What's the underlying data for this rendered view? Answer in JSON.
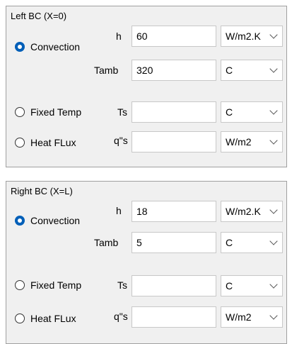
{
  "left_bc": {
    "title": "Left BC (X=0)",
    "convection_label": "Convection",
    "h_label": "h",
    "h_value": "60",
    "h_unit": "W/m2.K",
    "tamb_label": "Tamb",
    "tamb_value": "320",
    "tamb_unit": "C",
    "fixed_temp_label": "Fixed Temp",
    "ts_label": "Ts",
    "ts_value": "",
    "ts_unit": "C",
    "heat_flux_label": "Heat FLux",
    "q_label": "q\"s",
    "q_value": "",
    "q_unit": "W/m2",
    "selected": "convection"
  },
  "right_bc": {
    "title": "Right BC (X=L)",
    "convection_label": "Convection",
    "h_label": "h",
    "h_value": "18",
    "h_unit": "W/m2.K",
    "tamb_label": "Tamb",
    "tamb_value": "5",
    "tamb_unit": "C",
    "fixed_temp_label": "Fixed Temp",
    "ts_label": "Ts",
    "ts_value": "",
    "ts_unit": "C",
    "heat_flux_label": "Heat FLux",
    "q_label": "q\"s",
    "q_value": "",
    "q_unit": "W/m2",
    "selected": "convection"
  },
  "colors": {
    "accent": "#005fb8",
    "panel": "#f0f0f0",
    "border": "#a0a0a0"
  }
}
